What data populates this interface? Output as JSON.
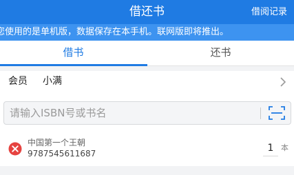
{
  "header": {
    "title": "借还书",
    "records_link": "借阅记录"
  },
  "notice": {
    "text": "您使用的是单机版，数据保存在本手机。联网版即将推出。"
  },
  "tabs": [
    {
      "label": "借书",
      "active": true
    },
    {
      "label": "还书",
      "active": false
    }
  ],
  "member": {
    "label": "会员",
    "name": "小满"
  },
  "search": {
    "placeholder": "请输入ISBN号或书名",
    "value": ""
  },
  "books": [
    {
      "title": "中国第一个王朝",
      "isbn": "9787545611687",
      "quantity": "1",
      "unit": "本"
    }
  ],
  "icons": {
    "delete": "delete-circle-icon",
    "scan": "scan-icon",
    "chevron": "chevron-right-icon"
  },
  "colors": {
    "primary": "#1f7be3",
    "notice_bg": "#3d93f0",
    "delete_red": "#e64340"
  }
}
